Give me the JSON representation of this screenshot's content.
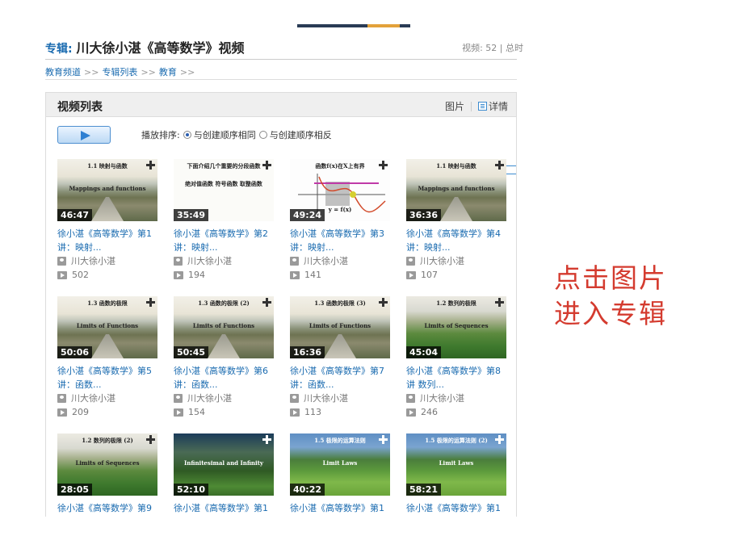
{
  "album": {
    "prefix": "专辑",
    "name": "川大徐小湛《高等数学》视频",
    "stats": "视频: 52 | 总时"
  },
  "breadcrumb": [
    "教育频道",
    "专辑列表",
    "教育"
  ],
  "breadcrumb_sep": ">>",
  "panel": {
    "title": "视频列表",
    "view_image": "图片",
    "view_detail": "详情"
  },
  "sort": {
    "label": "播放排序:",
    "option_same": "与创建顺序相同",
    "option_reverse": "与创建顺序相反",
    "selected": "same"
  },
  "videos": [
    {
      "duration": "46:47",
      "title": "徐小湛《高等数学》第1讲：映射...",
      "author": "川大徐小湛",
      "plays": "502",
      "thumb": "road",
      "slide_title": "1.1 映射与函数",
      "slide_sub": "Mappings and functions"
    },
    {
      "duration": "35:49",
      "title": "徐小湛《高等数学》第2讲：映射...",
      "author": "川大徐小湛",
      "plays": "194",
      "thumb": "white-slide",
      "slide_title": "下面介绍几个重要的分段函数",
      "slide_sub": "绝对值函数 符号函数 取整函数"
    },
    {
      "duration": "49:24",
      "title": "徐小湛《高等数学》第3讲：映射...",
      "author": "川大徐小湛",
      "plays": "141",
      "thumb": "graph-slide",
      "slide_title": "函数f(x)在X上有界",
      "slide_sub": "y = f(x)"
    },
    {
      "duration": "36:36",
      "title": "徐小湛《高等数学》第4讲：映射...",
      "author": "川大徐小湛",
      "plays": "107",
      "thumb": "road",
      "slide_title": "1.1 映射与函数",
      "slide_sub": "Mappings and functions"
    },
    {
      "duration": "50:06",
      "title": "徐小湛《高等数学》第5讲：函数...",
      "author": "川大徐小湛",
      "plays": "209",
      "thumb": "road",
      "slide_title": "1.3 函数的极限",
      "slide_sub": "Limits of Functions"
    },
    {
      "duration": "50:45",
      "title": "徐小湛《高等数学》第6讲：函数...",
      "author": "川大徐小湛",
      "plays": "154",
      "thumb": "road",
      "slide_title": "1.3 函数的极限 (2)",
      "slide_sub": "Limits of Functions"
    },
    {
      "duration": "16:36",
      "title": "徐小湛《高等数学》第7讲：函数...",
      "author": "川大徐小湛",
      "plays": "113",
      "thumb": "road",
      "slide_title": "1.3 函数的极限 (3)",
      "slide_sub": "Limits of Functions"
    },
    {
      "duration": "45:04",
      "title": "徐小湛《高等数学》第8讲 数列...",
      "author": "川大徐小湛",
      "plays": "246",
      "thumb": "castle",
      "slide_title": "1.2 数列的极限",
      "slide_sub": "Limits of Sequences"
    },
    {
      "duration": "28:05",
      "title": "徐小湛《高等数学》第9",
      "author": "",
      "plays": "",
      "thumb": "castle",
      "slide_title": "1.2 数列的极限 (2)",
      "slide_sub": "Limits of Sequences"
    },
    {
      "duration": "52:10",
      "title": "徐小湛《高等数学》第1",
      "author": "",
      "plays": "",
      "thumb": "meadow",
      "slide_title": "",
      "slide_sub": "Infinitesimal and Infinity"
    },
    {
      "duration": "40:22",
      "title": "徐小湛《高等数学》第1",
      "author": "",
      "plays": "",
      "thumb": "garden",
      "slide_title": "1.5 极限的运算法则",
      "slide_sub": "Limit Laws"
    },
    {
      "duration": "58:21",
      "title": "徐小湛《高等数学》第1",
      "author": "",
      "plays": "",
      "thumb": "garden",
      "slide_title": "1.5 极限的运算法则 (2)",
      "slide_sub": "Limit Laws"
    }
  ],
  "annotation": {
    "line1": "点击图片",
    "line2": "进入专辑",
    "color": "#d43b2f"
  },
  "colors": {
    "link": "#1a6bb0",
    "accent": "#2d7fd2"
  }
}
